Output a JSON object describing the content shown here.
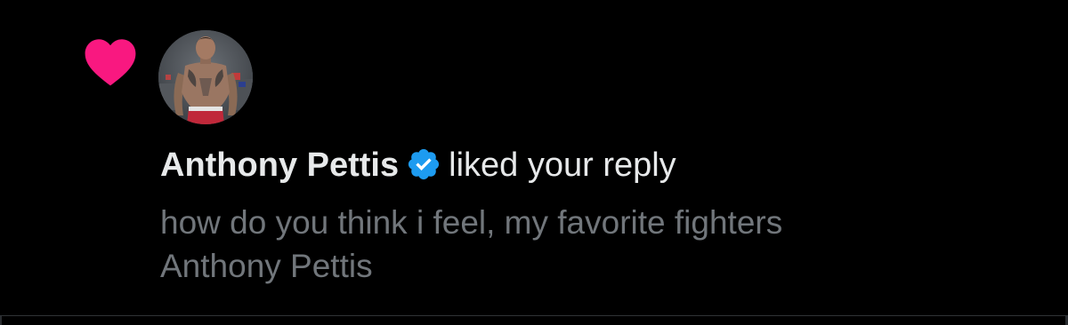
{
  "notification": {
    "type_icon": "heart-icon",
    "accent_color": "#f91880",
    "verified_color": "#1d9bf0",
    "user": {
      "name": "Anthony Pettis",
      "verified": true,
      "avatar": "fighter-avatar"
    },
    "action": "liked your reply",
    "reply_lines": [
      "how do you think i feel, my favorite fighters",
      "Anthony Pettis"
    ]
  }
}
